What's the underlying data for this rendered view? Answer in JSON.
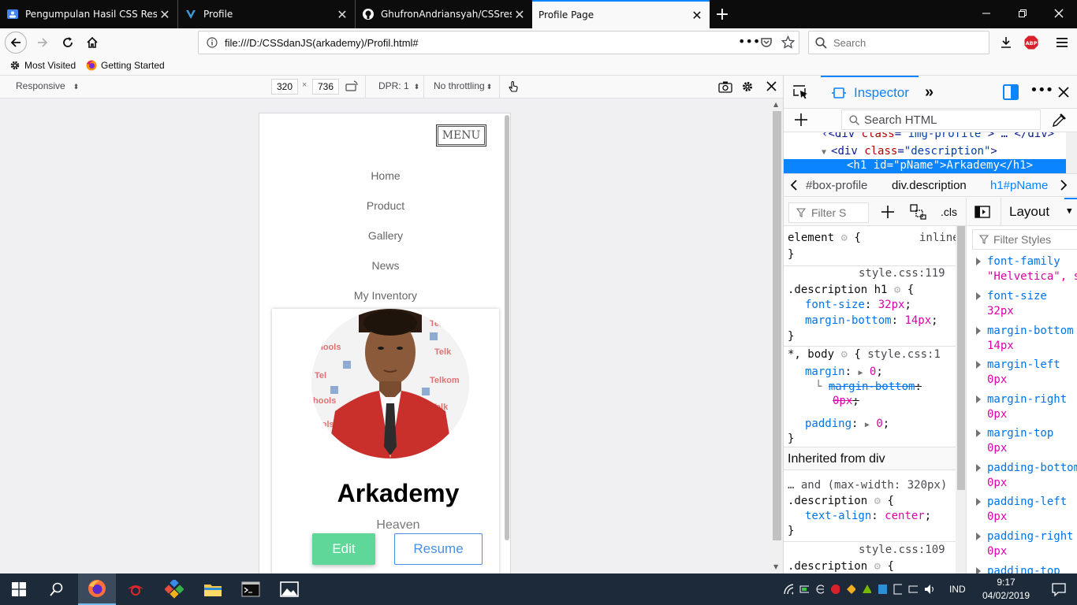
{
  "browser": {
    "tabs": [
      {
        "title": "Pengumpulan Hasil CSS Respo",
        "active": false
      },
      {
        "title": "Profile",
        "active": false
      },
      {
        "title": "GhufronAndriansyah/CSSrespo",
        "active": false
      },
      {
        "title": "Profile Page",
        "active": true
      }
    ],
    "url": "file:///D:/CSSdanJS(arkademy)/Profil.html#",
    "search_placeholder": "Search",
    "bookmarks": [
      "Most Visited",
      "Getting Started"
    ],
    "abp_label": "ABP"
  },
  "rdm": {
    "device": "Responsive",
    "width": "320",
    "height": "736",
    "dpr": "DPR: 1",
    "throttling": "No throttling"
  },
  "page": {
    "menu_label": "MENU",
    "nav_links": [
      "Home",
      "Product",
      "Gallery",
      "News",
      "My Inventory"
    ],
    "name": "Arkademy",
    "tagline": "Heaven",
    "edit_label": "Edit",
    "resume_label": "Resume"
  },
  "devtools": {
    "inspector_label": "Inspector",
    "search_placeholder": "Search HTML",
    "markup_lines": [
      {
        "indent": "<div ",
        "attr": "class",
        "val": "\"img-profile\"",
        "tail": "> … </div>"
      },
      {
        "indent": "<div ",
        "attr": "class",
        "val": "\"description\"",
        "tail": ">"
      },
      {
        "indent": "<h1 ",
        "attr": "id",
        "val": "\"pName\"",
        "tail": ">Arkademy</h1>"
      }
    ],
    "breadcrumbs": [
      "#box-profile",
      "div.description",
      "h1#pName"
    ],
    "filter_styles_placeholder": "Filter S",
    "cls_label": ".cls",
    "layout_label": "Layout",
    "filter_computed_placeholder": "Filter Styles",
    "rules": {
      "element": {
        "selector": "element",
        "source": "inline"
      },
      "rule1": {
        "source": "style.css:119",
        "selector": ".description h1",
        "props": [
          [
            "font-size",
            "32px"
          ],
          [
            "margin-bottom",
            "14px"
          ]
        ]
      },
      "rule2": {
        "selector": "*, body",
        "source": "style.css:1",
        "props": [
          [
            "margin",
            "0"
          ],
          [
            "margin-bottom",
            "0px"
          ],
          [
            "padding",
            "0"
          ]
        ]
      },
      "inherited_label": "Inherited from div",
      "rule3": {
        "media": "… and (max-width: 320px)",
        "selector": ".description",
        "props": [
          [
            "text-align",
            "center"
          ]
        ]
      },
      "rule4": {
        "source": "style.css:109",
        "selector": ".description"
      }
    },
    "computed": [
      [
        "font-family",
        "\"Helvetica\", s"
      ],
      [
        "font-size",
        "32px"
      ],
      [
        "margin-bottom",
        "14px"
      ],
      [
        "margin-left",
        "0px"
      ],
      [
        "margin-right",
        "0px"
      ],
      [
        "margin-top",
        "0px"
      ],
      [
        "padding-bottom",
        "0px"
      ],
      [
        "padding-left",
        "0px"
      ],
      [
        "padding-right",
        "0px"
      ],
      [
        "padding-top",
        ""
      ]
    ]
  },
  "taskbar": {
    "lang": "IND",
    "time": "9:17",
    "date": "04/02/2019"
  }
}
